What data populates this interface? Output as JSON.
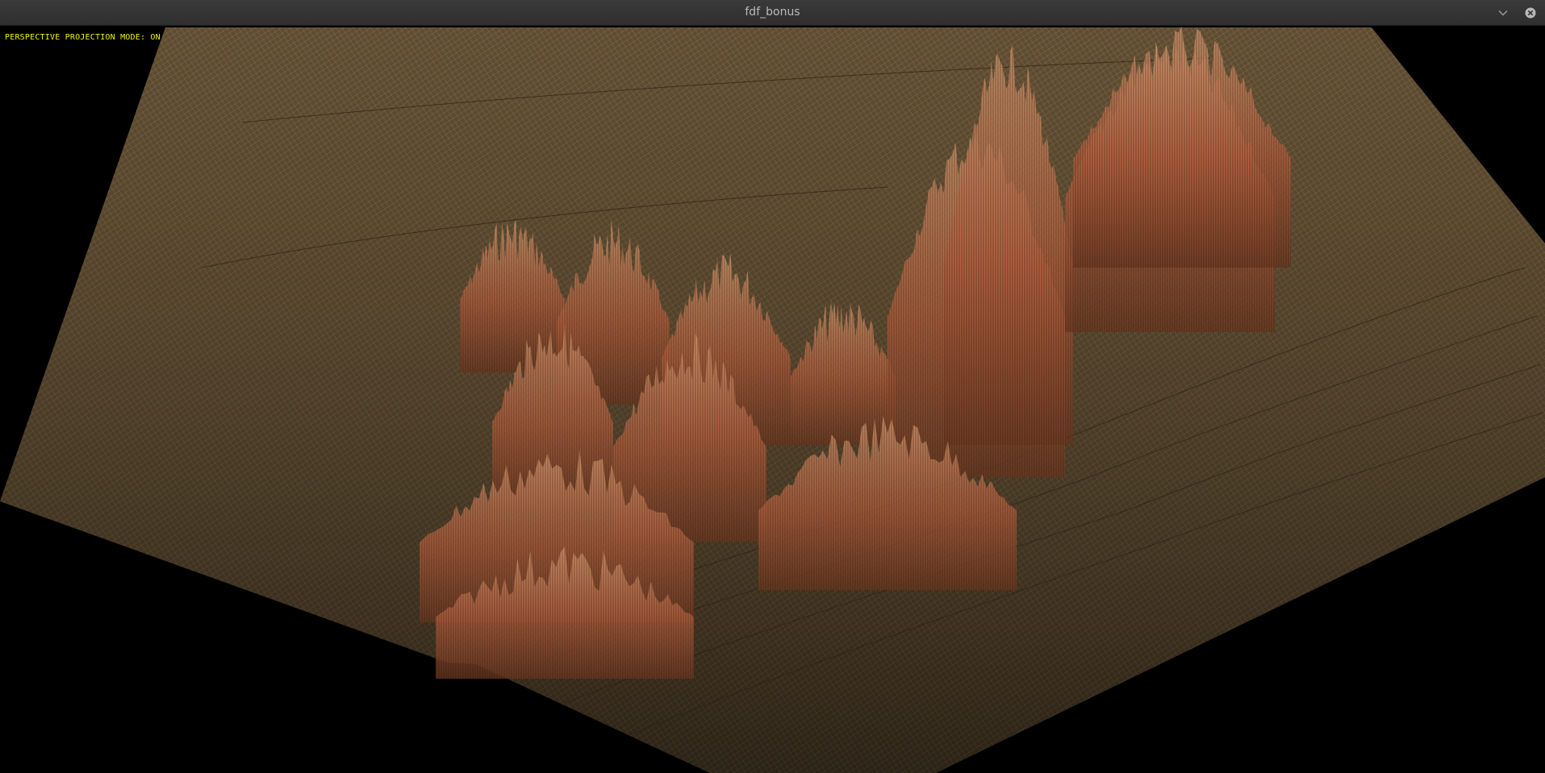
{
  "window": {
    "title": "fdf_bonus",
    "minimize_icon": "chevron-down-icon",
    "close_icon": "close-circle-icon"
  },
  "overlay": {
    "projection_status": "PERSPECTIVE PROJECTION MODE: ON"
  },
  "render": {
    "background_color": "#000000",
    "plane_color": "#8a7045",
    "peak_low_color": "#c8875a",
    "peak_high_color": "#a8472c",
    "overlay_text_color": "#f2f200"
  }
}
